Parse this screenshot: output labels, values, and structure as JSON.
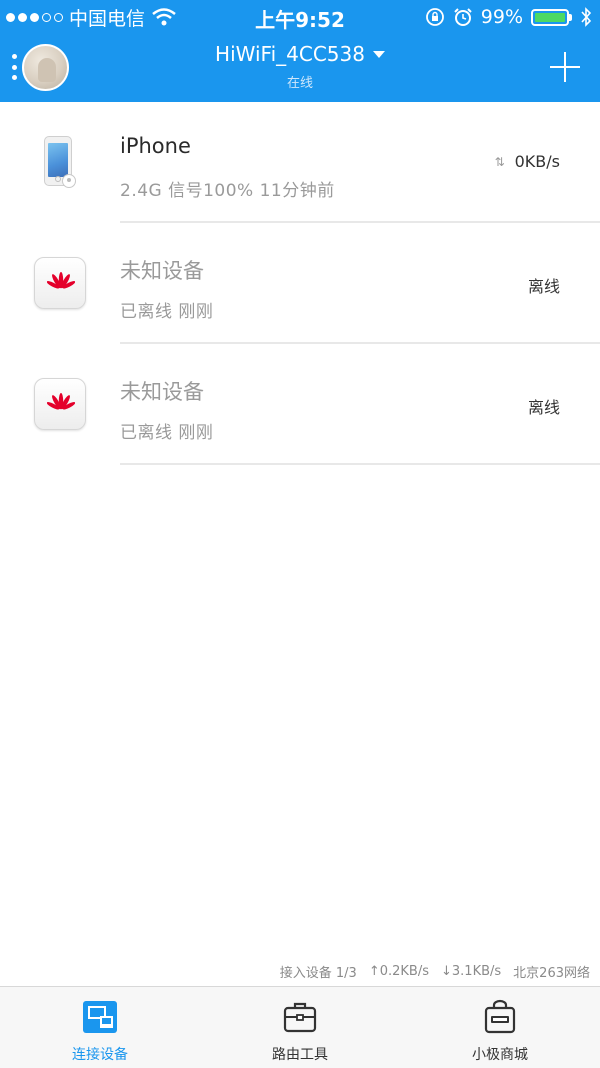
{
  "status_bar": {
    "carrier": "中国电信",
    "time": "上午9:52",
    "battery_percent": "99%",
    "battery_level": 0.99
  },
  "header": {
    "network_name": "HiWiFi_4CC538",
    "network_status": "在线"
  },
  "devices": [
    {
      "name": "iPhone",
      "detail": "2.4G  信号100%  11分钟前",
      "state": "0KB/s",
      "icon": "iphone-icon"
    },
    {
      "name": "未知设备",
      "detail": "已离线  刚刚",
      "state": "离线",
      "icon": "huawei-logo-icon"
    },
    {
      "name": "未知设备",
      "detail": "已离线  刚刚",
      "state": "离线",
      "icon": "huawei-logo-icon"
    }
  ],
  "stats": {
    "connected": "接入设备 1/3",
    "upload": "↑0.2KB/s",
    "download": "↓3.1KB/s",
    "isp": "北京263网络"
  },
  "tabs": [
    {
      "label": "连接设备",
      "icon": "devices-icon",
      "active": true
    },
    {
      "label": "路由工具",
      "icon": "toolbox-icon",
      "active": false
    },
    {
      "label": "小极商城",
      "icon": "shop-bag-icon",
      "active": false
    }
  ],
  "colors": {
    "primary": "#1a96ee",
    "battery": "#4cd964",
    "huawei_red": "#e4002b"
  }
}
